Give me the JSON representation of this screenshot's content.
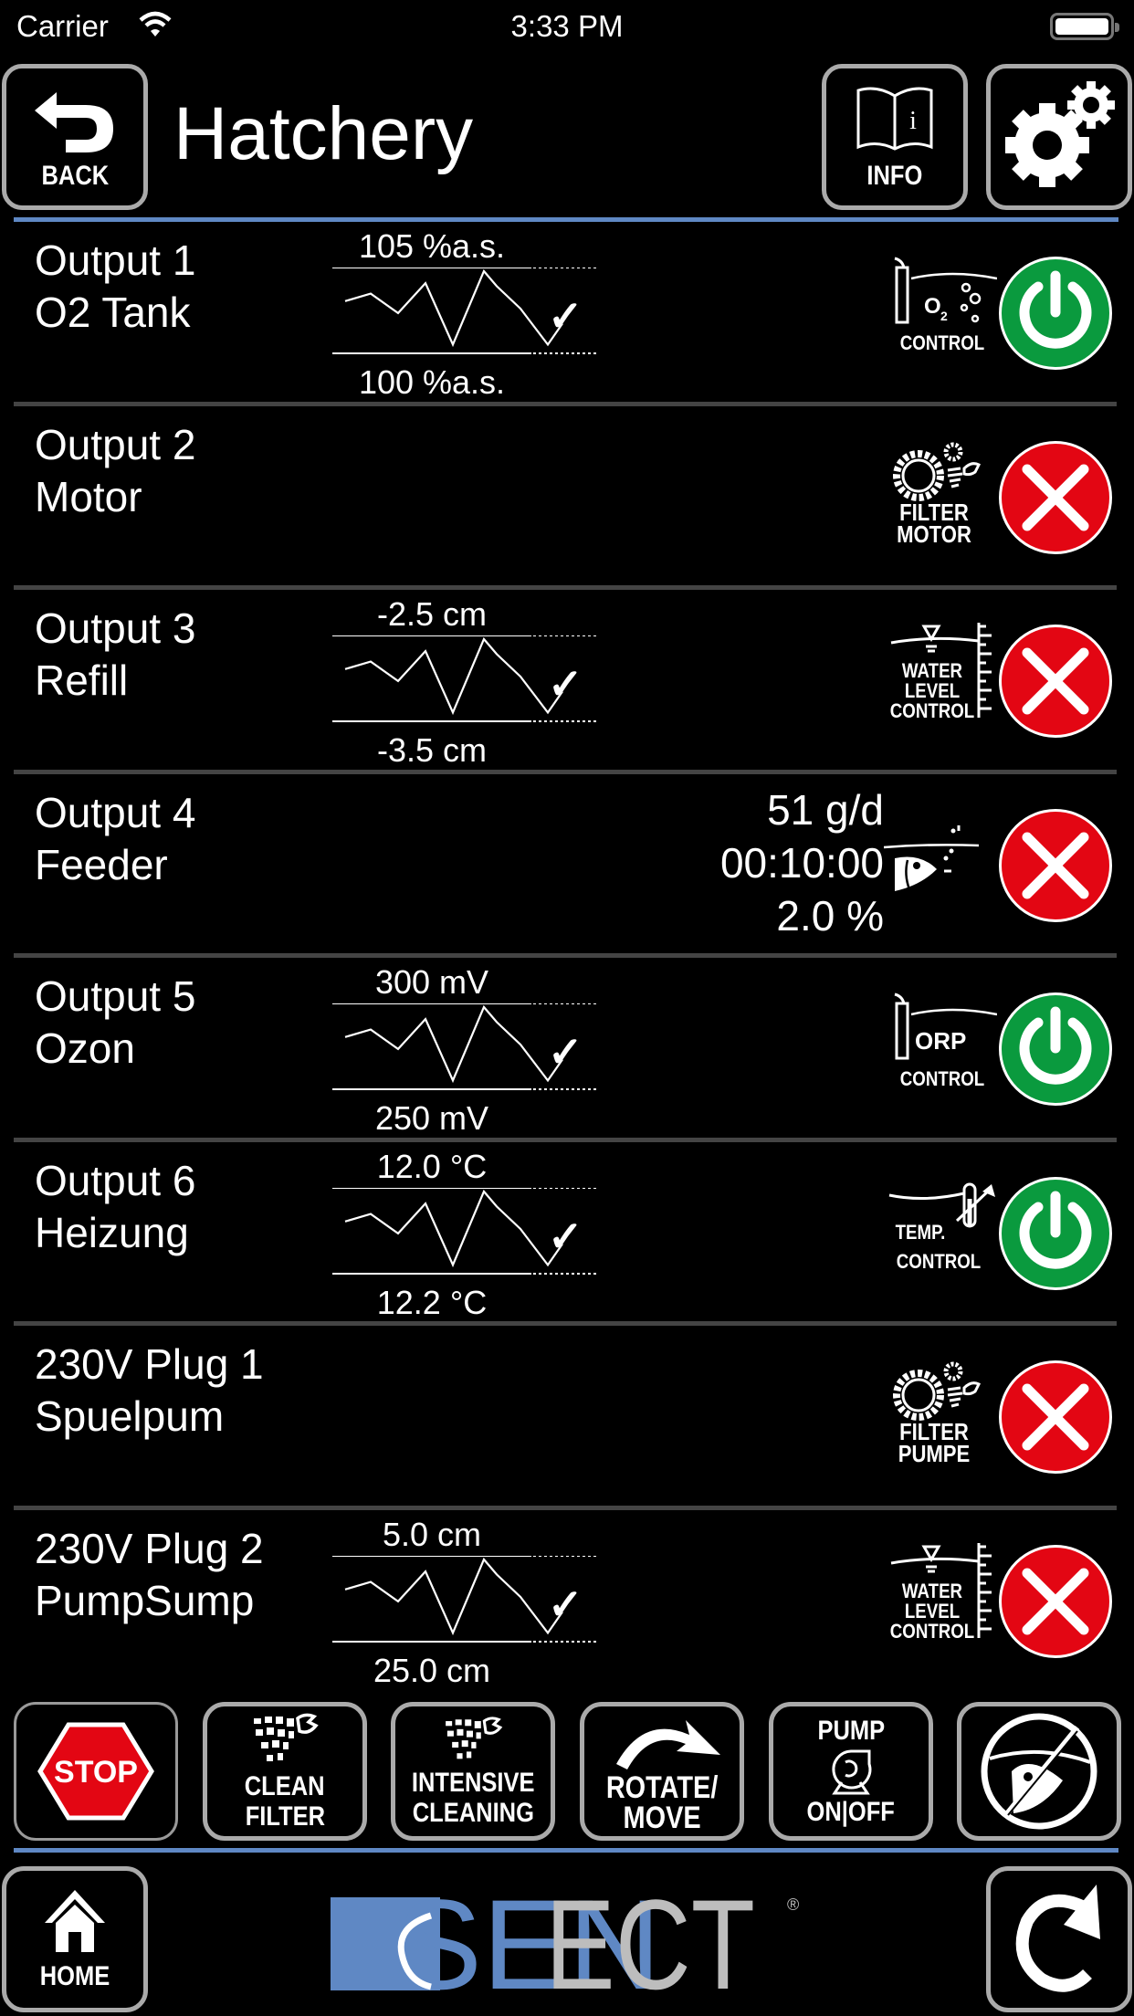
{
  "status_bar": {
    "carrier": "Carrier",
    "time": "3:33 PM"
  },
  "header": {
    "title": "Hatchery",
    "back_label": "BACK",
    "info_label": "INFO",
    "accent_color": "#5f88c4"
  },
  "outputs": [
    {
      "line1": "Output 1",
      "line2": "O2 Tank",
      "trend": true,
      "upper": "105 %a.s.",
      "lower": "100 %a.s.",
      "ok": "✓",
      "icon": "o2-control-icon",
      "icon_text": [
        "CONTROL"
      ],
      "icon_sub": "O2",
      "state": "on"
    },
    {
      "line1": "Output 2",
      "line2": "Motor",
      "trend": false,
      "icon": "filter-motor-icon",
      "icon_text": [
        "FILTER",
        "MOTOR"
      ],
      "state": "off"
    },
    {
      "line1": "Output 3",
      "line2": "Refill",
      "trend": true,
      "upper": "-2.5 cm",
      "lower": "-3.5 cm",
      "ok": "✓",
      "icon": "water-level-control-icon",
      "icon_text": [
        "WATER",
        "LEVEL",
        "CONTROL"
      ],
      "state": "off"
    },
    {
      "line1": "Output 4",
      "line2": "Feeder",
      "trend": false,
      "feed": [
        "51 g/d",
        "00:10:00",
        "2.0 %"
      ],
      "icon": "feeder-fish-icon",
      "icon_text": [],
      "state": "off"
    },
    {
      "line1": "Output 5",
      "line2": "Ozon",
      "trend": true,
      "upper": "300 mV",
      "lower": "250 mV",
      "ok": "✓",
      "icon": "orp-control-icon",
      "icon_text": [
        "CONTROL"
      ],
      "icon_sub": "ORP",
      "state": "on"
    },
    {
      "line1": "Output 6",
      "line2": "Heizung",
      "trend": true,
      "upper": "12.0 °C",
      "lower": "12.2 °C",
      "ok": "✓",
      "icon": "temp-control-icon",
      "icon_text": [
        "TEMP.",
        "CONTROL"
      ],
      "state": "on"
    },
    {
      "line1": "230V Plug 1",
      "line2": "Spuelpum",
      "trend": false,
      "icon": "filter-pump-icon",
      "icon_text": [
        "FILTER",
        "PUMPE"
      ],
      "state": "off"
    },
    {
      "line1": "230V Plug 2",
      "line2": "PumpSump",
      "trend": true,
      "upper": "5.0 cm",
      "lower": "25.0 cm",
      "ok": "✓",
      "icon": "water-level-control-icon",
      "icon_text": [
        "WATER",
        "LEVEL",
        "CONTROL"
      ],
      "state": "off"
    }
  ],
  "state_colors": {
    "on": "#0a9a3e",
    "off": "#e30613"
  },
  "toolbar": {
    "stop": "STOP",
    "clean_filter": [
      "CLEAN",
      "FILTER"
    ],
    "intensive_cleaning": [
      "INTENSIVE",
      "CLEANING"
    ],
    "rotate_move": [
      "ROTATE/",
      "MOVE"
    ],
    "pump": [
      "PUMP",
      "ON|OFF"
    ]
  },
  "footer": {
    "home_label": "HOME",
    "logo_text": "SENECT",
    "logo_mark": "®"
  }
}
